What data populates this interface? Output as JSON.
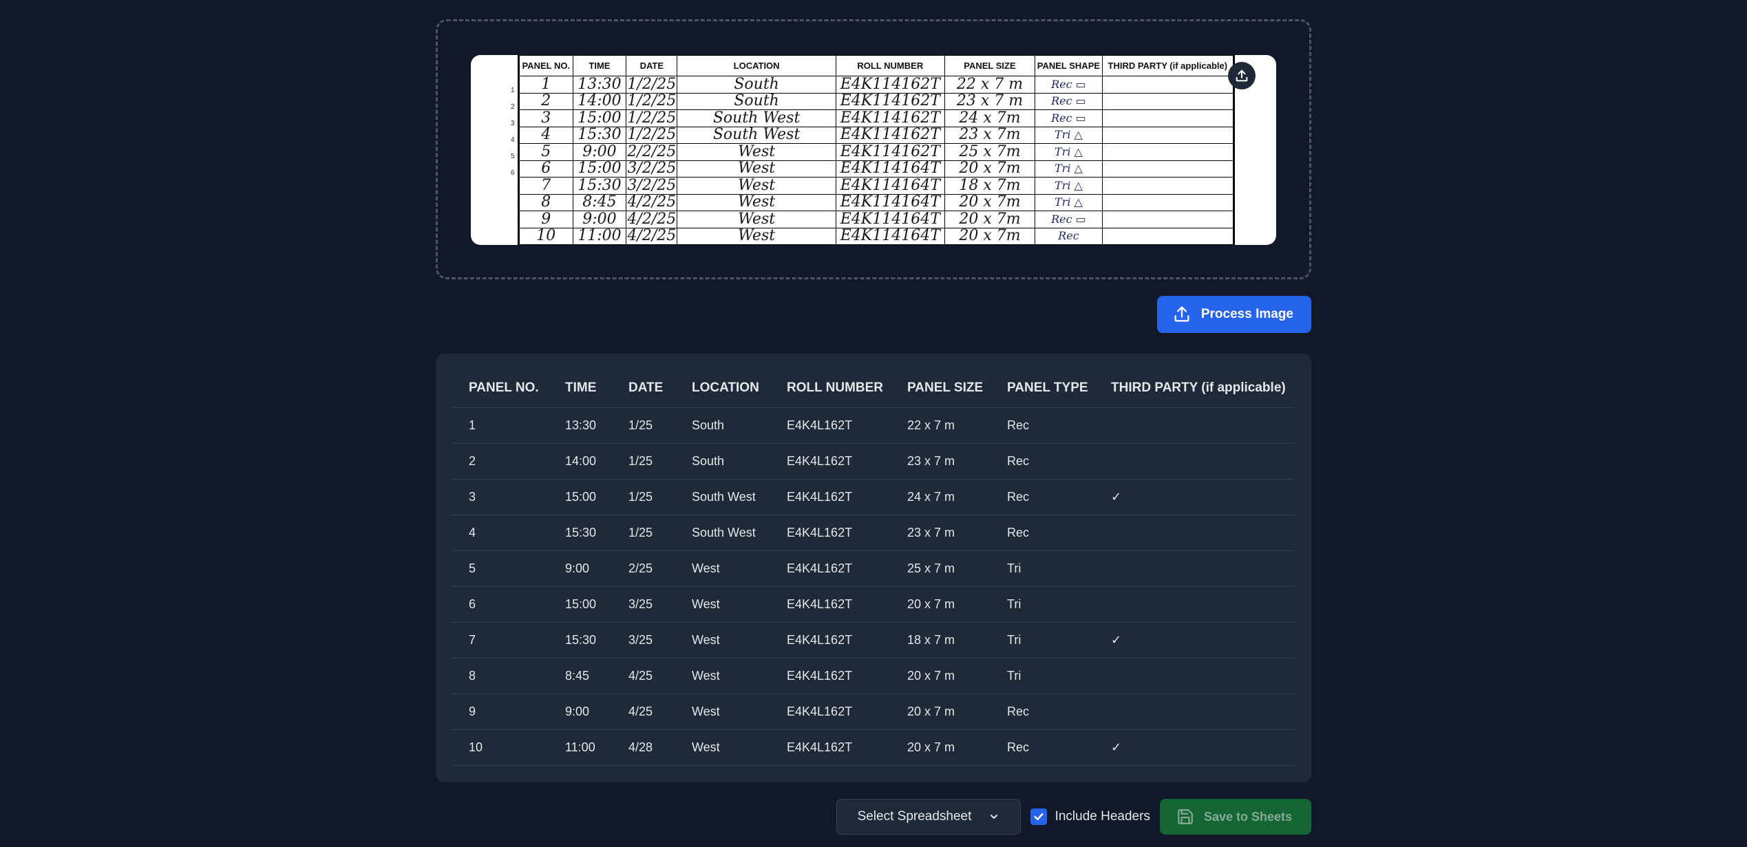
{
  "upload": {
    "sheet_headers": [
      "PANEL NO.",
      "TIME",
      "DATE",
      "LOCATION",
      "ROLL NUMBER",
      "PANEL SIZE",
      "PANEL SHAPE",
      "THIRD PARTY (if applicable)"
    ],
    "sheet_rows": [
      [
        "1",
        "13:30",
        "1/2/25",
        "South",
        "E4K114162T",
        "22 x 7 m",
        "Rec ▭"
      ],
      [
        "2",
        "14:00",
        "1/2/25",
        "South",
        "E4K114162T",
        "23 x 7 m",
        "Rec ▭"
      ],
      [
        "3",
        "15:00",
        "1/2/25",
        "South West",
        "E4K114162T",
        "24 x 7m",
        "Rec ▭"
      ],
      [
        "4",
        "15:30",
        "1/2/25",
        "South West",
        "E4K114162T",
        "23 x 7m",
        "Tri △"
      ],
      [
        "5",
        "9:00",
        "2/2/25",
        "West",
        "E4K114162T",
        "25 x 7m",
        "Tri △"
      ],
      [
        "6",
        "15:00",
        "3/2/25",
        "West",
        "E4K114164T",
        "20 x 7m",
        "Tri △"
      ],
      [
        "7",
        "15:30",
        "3/2/25",
        "West",
        "E4K114164T",
        "18 x 7m",
        "Tri △"
      ],
      [
        "8",
        "8:45",
        "4/2/25",
        "West",
        "E4K114164T",
        "20 x 7m",
        "Tri △"
      ],
      [
        "9",
        "9:00",
        "4/2/25",
        "West",
        "E4K114164T",
        "20 x 7m",
        "Rec ▭"
      ],
      [
        "10",
        "11:00",
        "4/2/25",
        "West",
        "E4K114164T",
        "20 x 7m",
        "Rec"
      ]
    ],
    "margin_marks": [
      "1",
      "2",
      "3",
      "4",
      "5",
      "6"
    ]
  },
  "process_button": {
    "label": "Process Image"
  },
  "results": {
    "headers": [
      "PANEL NO.",
      "TIME",
      "DATE",
      "LOCATION",
      "ROLL NUMBER",
      "PANEL SIZE",
      "PANEL TYPE",
      "THIRD PARTY (if applicable)"
    ],
    "rows": [
      [
        "1",
        "13:30",
        "1/25",
        "South",
        "E4K4L162T",
        "22 x 7 m",
        "Rec",
        ""
      ],
      [
        "2",
        "14:00",
        "1/25",
        "South",
        "E4K4L162T",
        "23 x 7 m",
        "Rec",
        ""
      ],
      [
        "3",
        "15:00",
        "1/25",
        "South West",
        "E4K4L162T",
        "24 x 7 m",
        "Rec",
        "✓"
      ],
      [
        "4",
        "15:30",
        "1/25",
        "South West",
        "E4K4L162T",
        "23 x 7 m",
        "Rec",
        ""
      ],
      [
        "5",
        "9:00",
        "2/25",
        "West",
        "E4K4L162T",
        "25 x 7 m",
        "Tri",
        ""
      ],
      [
        "6",
        "15:00",
        "3/25",
        "West",
        "E4K4L162T",
        "20 x 7 m",
        "Tri",
        ""
      ],
      [
        "7",
        "15:30",
        "3/25",
        "West",
        "E4K4L162T",
        "18 x 7 m",
        "Tri",
        "✓"
      ],
      [
        "8",
        "8:45",
        "4/25",
        "West",
        "E4K4L162T",
        "20 x 7 m",
        "Tri",
        ""
      ],
      [
        "9",
        "9:00",
        "4/25",
        "West",
        "E4K4L162T",
        "20 x 7 m",
        "Rec",
        ""
      ],
      [
        "10",
        "11:00",
        "4/28",
        "West",
        "E4K4L162T",
        "20 x 7 m",
        "Rec",
        "✓"
      ]
    ]
  },
  "actions": {
    "select_spreadsheet": "Select Spreadsheet",
    "include_headers_label": "Include Headers",
    "include_headers_checked": true,
    "save_label": "Save to Sheets"
  },
  "colors": {
    "background": "#111827",
    "card": "#1f2937",
    "primary": "#2563eb",
    "save_button": "#166534"
  },
  "icons": [
    "upload-icon",
    "save-icon",
    "chevron-down-icon",
    "check-icon"
  ]
}
